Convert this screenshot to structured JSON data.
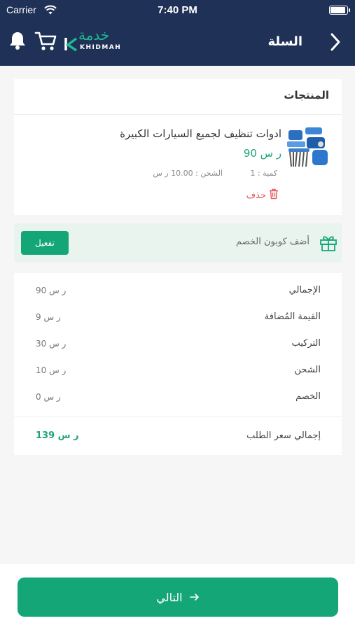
{
  "status_bar": {
    "carrier": "Carrier",
    "time": "7:40 PM"
  },
  "header": {
    "title": "السلة",
    "logo_arabic": "خدمة",
    "logo_english": "KHIDMAH",
    "icons": [
      "bell-icon",
      "cart-icon",
      "chevron-right-icon"
    ]
  },
  "products": {
    "section_title": "المنتجات",
    "items": [
      {
        "name": "ادوات تنظيف لجميع السيارات الكبيرة",
        "price": "90 ر س",
        "quantity": "كمية : 1",
        "shipping": "الشحن : 10.00 ر س",
        "delete_label": "حذف"
      }
    ]
  },
  "coupon": {
    "label": "أضف كوبون الخصم",
    "button": "تفعيل"
  },
  "summary": {
    "rows": [
      {
        "label": "الإجمالي",
        "value": "90 ر س"
      },
      {
        "label": "القيمة المُضافة",
        "value": "9 ر س"
      },
      {
        "label": "التركيب",
        "value": "30 ر س"
      },
      {
        "label": "الشحن",
        "value": "10 ر س"
      },
      {
        "label": "الخصم",
        "value": "0 ر س"
      }
    ],
    "total_label": "إجمالي سعر الطلب",
    "total_value": "139 ر س"
  },
  "footer": {
    "next_label": "التالي"
  },
  "colors": {
    "header": "#1f3156",
    "accent": "#14a677",
    "danger": "#e55a5a",
    "coupon_bg": "#e9f4ef"
  }
}
